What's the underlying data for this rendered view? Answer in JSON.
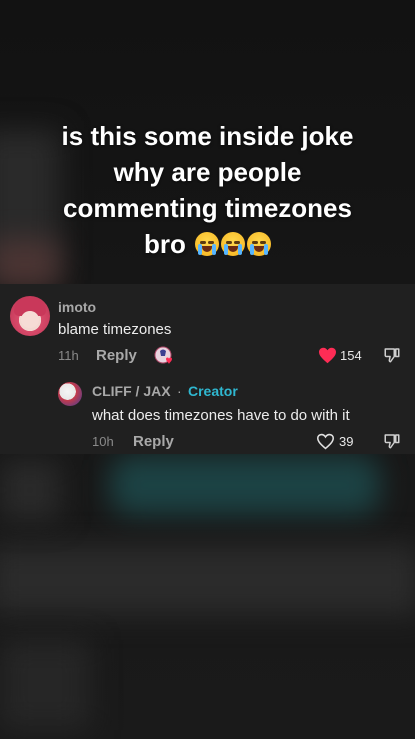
{
  "caption": {
    "line1": "is this some inside joke",
    "line2": "why are people",
    "line3": "commenting timezones",
    "line4": "bro",
    "emoji_icons": [
      "loudly-crying-face-icon",
      "loudly-crying-face-icon",
      "loudly-crying-face-icon"
    ]
  },
  "comment": {
    "username": "imoto",
    "text": "blame timezones",
    "time": "11h",
    "reply_label": "Reply",
    "like_count": "154",
    "liked": true,
    "liked_by_creator": true
  },
  "reply": {
    "username": "CLIFF / JAX",
    "separator": "·",
    "badge": "Creator",
    "text": "what does timezones have to do with it",
    "time": "10h",
    "reply_label": "Reply",
    "like_count": "39",
    "liked": false
  },
  "colors": {
    "like_active": "#fe2c55",
    "creator_badge": "#2fb7d0"
  }
}
